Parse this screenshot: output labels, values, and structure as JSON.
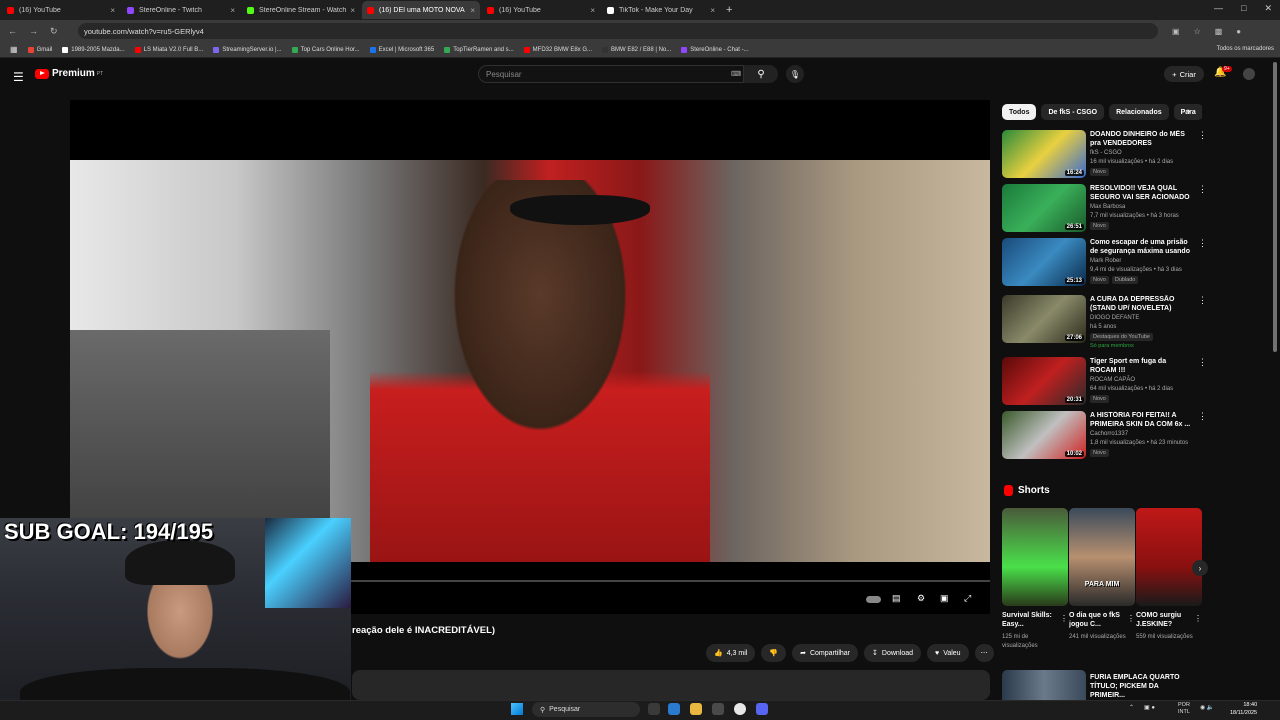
{
  "browser": {
    "tabs": [
      {
        "title": "(16) YouTube",
        "color": "#ff0000",
        "active": false
      },
      {
        "title": "StereOnline - Twitch",
        "color": "#9146ff",
        "active": false
      },
      {
        "title": "StereOnline Stream - Watch Liv",
        "color": "#53fc18",
        "active": false
      },
      {
        "title": "(16) DEI uma MOTO NOVA",
        "color": "#ff0000",
        "active": true
      },
      {
        "title": "(16) YouTube",
        "color": "#ff0000",
        "active": false
      },
      {
        "title": "TikTok - Make Your Day",
        "color": "#ffffff",
        "active": false
      }
    ],
    "url": "youtube.com/watch?v=ru5-GERlyv4",
    "bookmarks": [
      {
        "label": "Gmail",
        "color": "#ea4335"
      },
      {
        "label": "1989-2005 Mazda...",
        "color": "#ffffff"
      },
      {
        "label": "LS Miata V2.0 Full B...",
        "color": "#ff0000"
      },
      {
        "label": "StreamingServer.io |...",
        "color": "#7b68ee"
      },
      {
        "label": "Top Cars Online Hor...",
        "color": "#34a853"
      },
      {
        "label": "Excel | Microsoft 365",
        "color": "#1a73e8"
      },
      {
        "label": "TopTierRamen and s...",
        "color": "#34a853"
      },
      {
        "label": "MFD32 BMW E8x G...",
        "color": "#ff0000"
      },
      {
        "label": "BMW E82 / E88 | No...",
        "color": "#333333"
      },
      {
        "label": "StereOnline - Chat -...",
        "color": "#9146ff"
      }
    ],
    "all_bookmarks": "Todos os marcadores"
  },
  "yt": {
    "logo_text": "Premium",
    "logo_sup": "PT",
    "search_placeholder": "Pesquisar",
    "create_label": "Criar",
    "notif_count": "9+"
  },
  "video": {
    "title": "reação dele é INACREDITÁVEL)",
    "likes": "4,3 mil",
    "share_label": "Compartilhar",
    "download_label": "Download",
    "thanks_label": "Valeu"
  },
  "overlay": {
    "sub_goal": "SUB GOAL: 194/195"
  },
  "chips": [
    "Todos",
    "De fkS - CSGO",
    "Relacionados",
    "Para"
  ],
  "recommendations": [
    {
      "title": "DOANDO DINHEIRO do MÊS pra VENDEDORES AMBULANTES!",
      "channel": "fkS - CSGO",
      "meta": "16 mil visualizações • há 2 dias",
      "duration": "16:24",
      "badges": [
        "Novo"
      ],
      "thumb": "linear-gradient(135deg,#2a8a3a,#e8d040 50%,#3a6ad0)"
    },
    {
      "title": "RESOLVIDO!! VEJA QUAL SEGURO VAI SER ACIONADO ...",
      "channel": "Max Barbosa",
      "meta": "7,7 mil visualizações • há 3 horas",
      "duration": "26:51",
      "badges": [
        "Novo"
      ],
      "thumb": "linear-gradient(135deg,#1a7a3a,#3ab05a 50%,#1a5a2a)"
    },
    {
      "title": "Como escapar de uma prisão de segurança máxima usando ...",
      "channel": "Mark Rober",
      "meta": "9,4 mi de visualizações • há 3 dias",
      "duration": "25:13",
      "badges": [
        "Novo",
        "Dublado"
      ],
      "thumb": "linear-gradient(135deg,#1a4a7a,#3a8ac0 50%,#0a2a4a)"
    },
    {
      "title": "A CURA DA DEPRESSÃO (STAND UP/ NOVELETA)",
      "channel": "DIOGO DEFANTE",
      "meta": "há 5 anos",
      "duration": "27:06",
      "badges": [
        "Destaques do YouTube"
      ],
      "extra": "Só para membros",
      "thumb": "linear-gradient(135deg,#3a3a2a,#8a8a6a 50%,#2a2a1a)"
    },
    {
      "title": "Tiger Sport em fuga da ROCAM !!!",
      "channel": "ROCAM CAPÃO",
      "meta": "64 mil visualizações • há 2 dias",
      "duration": "20:31",
      "badges": [
        "Novo"
      ],
      "thumb": "linear-gradient(135deg,#5a0a0a,#c02020 50%,#2a2a2a)"
    },
    {
      "title": "A HISTÓRIA FOI FEITA!! A PRIMEIRA SKIN DA COM 6x ...",
      "channel": "Cachorro1337",
      "meta": "1,8 mil visualizações • há 23 minutos",
      "duration": "10:02",
      "badges": [
        "Novo"
      ],
      "thumb": "linear-gradient(135deg,#3a5a2a,#c0c0c0 50%,#d02020)"
    }
  ],
  "shorts": {
    "heading": "Shorts",
    "items": [
      {
        "title": "Survival Skills: Easy...",
        "views": "125 mi de visualizações",
        "caption": "",
        "thumb": "linear-gradient(180deg,#4a5a3a,#4ae04a 60%,#2a3a1a)"
      },
      {
        "title": "O dia que o fkS jogou C...",
        "views": "241 mil visualizações",
        "caption": "PARA MIM",
        "thumb": "linear-gradient(180deg,#3a4a5a,#b89070 50%,#2a2a2a)"
      },
      {
        "title": "COMO surgiu J.ESKINE?",
        "views": "559 mil visualizações",
        "caption": "",
        "thumb": "linear-gradient(180deg,#c01818,#8a1010 60%,#1a1a1a)"
      }
    ]
  },
  "bottom_rec": {
    "title": "FURIA EMPLACA QUARTO TÍTULO; PICKEM DA PRIMEIR..."
  },
  "taskbar": {
    "search_label": "Pesquisar",
    "lang": "POR",
    "kb": "INTL",
    "time": "18:40",
    "date": "18/11/2025"
  }
}
